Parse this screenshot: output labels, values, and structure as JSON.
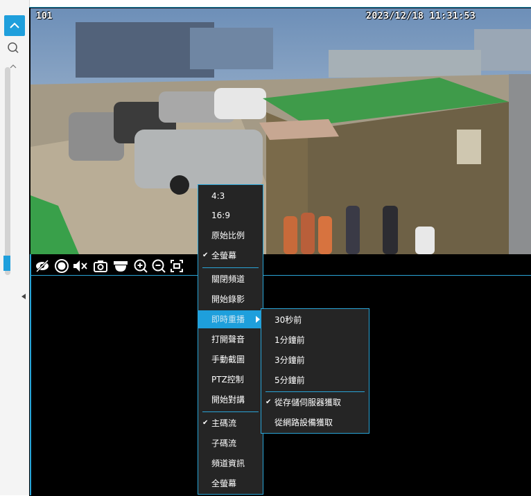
{
  "osd": {
    "channel": "101",
    "timestamp": "2023/12/18 11:31:53"
  },
  "toolbar": {
    "icons": [
      "hide-icon",
      "record-icon",
      "mute-icon",
      "snapshot-icon",
      "ptz-dome-icon",
      "zoom-in-icon",
      "zoom-out-icon",
      "fit-screen-icon"
    ]
  },
  "context_menu": {
    "items": [
      {
        "label": "4:3"
      },
      {
        "label": "16:9"
      },
      {
        "label": "原始比例"
      },
      {
        "label": "全螢幕",
        "checked": true
      },
      {
        "label": "關閉頻道"
      },
      {
        "label": "開始錄影"
      },
      {
        "label": "即時重播",
        "highlighted": true,
        "has_submenu": true
      },
      {
        "label": "打開聲音"
      },
      {
        "label": "手動截圖"
      },
      {
        "label": "PTZ控制"
      },
      {
        "label": "開始對講"
      },
      {
        "label": "主碼流",
        "checked": true
      },
      {
        "label": "子碼流"
      },
      {
        "label": "頻道資訊"
      },
      {
        "label": "全螢幕"
      }
    ]
  },
  "submenu": {
    "items": [
      {
        "label": "30秒前"
      },
      {
        "label": "1分鐘前"
      },
      {
        "label": "3分鐘前"
      },
      {
        "label": "5分鐘前"
      },
      {
        "label": "從存儲伺服器獲取",
        "checked": true
      },
      {
        "label": "從網路設備獲取"
      }
    ]
  },
  "colors": {
    "accent": "#1e9fdc",
    "menu_bg": "#252525",
    "border": "#2aa5d8"
  }
}
